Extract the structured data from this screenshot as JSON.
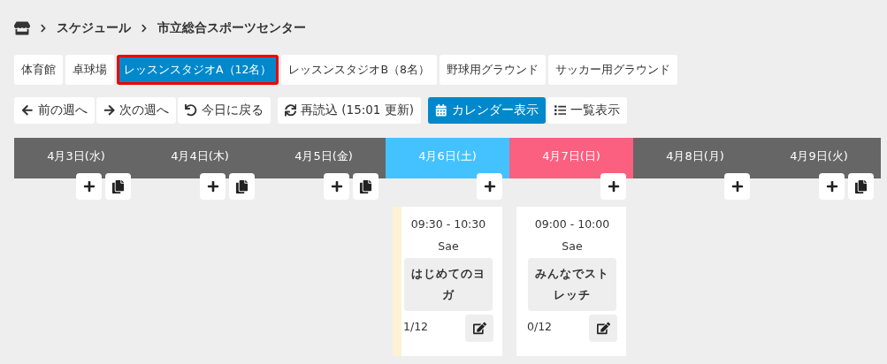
{
  "breadcrumb": [
    "スケジュール",
    "市立総合スポーツセンター"
  ],
  "facilities": [
    {
      "label": "体育館",
      "selected": false
    },
    {
      "label": "卓球場",
      "selected": false
    },
    {
      "label": "レッスンスタジオA（12名）",
      "selected": true
    },
    {
      "label": "レッスンスタジオB（8名）",
      "selected": false
    },
    {
      "label": "野球用グラウンド",
      "selected": false
    },
    {
      "label": "サッカー用グラウンド",
      "selected": false
    }
  ],
  "nav_buttons": [
    {
      "kind": "prev",
      "label": "前の週へ"
    },
    {
      "kind": "next",
      "label": "次の週へ"
    },
    {
      "kind": "today",
      "label": "今日に戻る"
    }
  ],
  "reload": {
    "label": "再読込 (15:01 更新)"
  },
  "views": [
    {
      "kind": "calendar",
      "label": "カレンダー表示",
      "selected": true
    },
    {
      "kind": "list",
      "label": "一覧表示",
      "selected": false
    }
  ],
  "days": [
    {
      "label": "4月3日(水)",
      "kind": "weekday",
      "copyable": true
    },
    {
      "label": "4月4日(木)",
      "kind": "weekday",
      "copyable": true
    },
    {
      "label": "4月5日(金)",
      "kind": "weekday",
      "copyable": true
    },
    {
      "label": "4月6日(土)",
      "kind": "saturday",
      "copyable": false,
      "events": [
        {
          "time": "09:30 - 10:30",
          "instructor": "Sae",
          "title": "はじめてのヨガ",
          "count": "1/12",
          "color": "#fdf2d4"
        }
      ]
    },
    {
      "label": "4月7日(日)",
      "kind": "sunday",
      "copyable": false,
      "events": [
        {
          "time": "09:00 - 10:00",
          "instructor": "Sae",
          "title": "みんなでストレッチ",
          "count": "0/12",
          "color": "#ffffff"
        }
      ]
    },
    {
      "label": "4月8日(月)",
      "kind": "weekday",
      "copyable": false
    },
    {
      "label": "4月9日(火)",
      "kind": "weekday",
      "copyable": true
    }
  ]
}
